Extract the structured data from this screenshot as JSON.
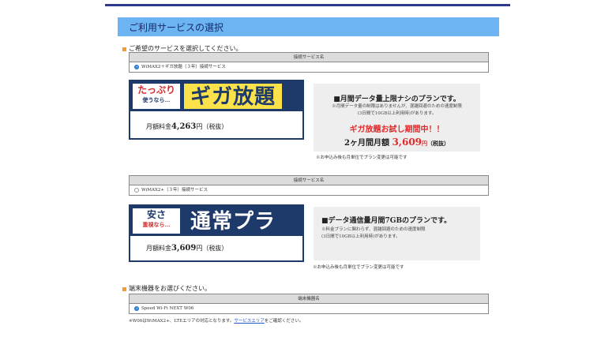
{
  "header": {
    "title": "ご利用サービスの選択"
  },
  "service_section": {
    "label": "ご希望のサービスを選択してください。"
  },
  "plan_table_1": {
    "header": "接続サービス名",
    "option": "WiMAX2＋ギガ放題（３年）接続サービス",
    "selected": true
  },
  "giga_banner": {
    "tag_line1": "たっぷり",
    "tag_line2": "使うなら…",
    "title": "ギガ放題",
    "price_prefix": "月額料金",
    "price": "4,263",
    "price_suffix": "円（税抜）"
  },
  "giga_info": {
    "heading": "■月間データ量上限ナシのプランです。",
    "note1": "※月間データ量の制限はありませんが、混雑回避のための速度制限",
    "note2": "(3日間で10GB以上利用時)があります。",
    "trial": "ギガ放題お試し期間中！！",
    "price_prefix": "2ヶ月間月額",
    "price": "3,609",
    "price_unit": "円",
    "price_suffix": "（税抜）"
  },
  "giga_footnote": "※お申込み後も月単位でプラン変更は可能です",
  "plan_table_2": {
    "header": "接続サービス名",
    "option": "WiMAX2+（３年）接続サービス",
    "selected": false
  },
  "normal_banner": {
    "tag_line1": "安さ",
    "tag_line2": "重視なら…",
    "title": "通常プラン",
    "price_prefix": "月額料金",
    "price": "3,609",
    "price_suffix": "円（税抜）"
  },
  "normal_info": {
    "heading": "■データ通信量月間7GBのプランです。",
    "note1": "※料金プランに関わらず、混雑回避のための速度制限",
    "note2": "(3日間で10GB以上利用時)があります。"
  },
  "normal_footnote": "※お申込み後も月単位でプラン変更は可能です",
  "device_section": {
    "label": "端末機器をお選びください。"
  },
  "device_table": {
    "header": "端末機器名",
    "option": "Speed Wi-Fi NEXT W06",
    "selected": true
  },
  "bottom_note": {
    "prefix": "※W06はWiMAX2+、LTEエリアの対応となります。",
    "link": "サービスエリア",
    "suffix": "をご確認ください。"
  },
  "colors": {
    "accent": "#6cb4f2",
    "navy": "#1e3a6b",
    "yellow": "#fbe24a",
    "red": "#e02a2a",
    "orange": "#f29b30"
  }
}
